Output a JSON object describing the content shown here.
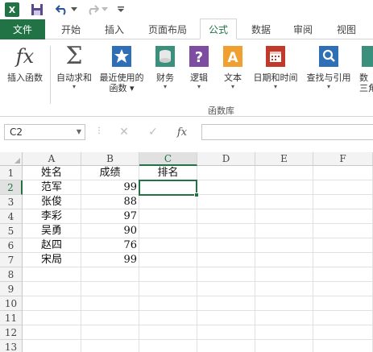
{
  "quick_access": {
    "app_logo": "X",
    "save_icon": "save-icon",
    "undo_icon": "undo-icon",
    "redo_icon": "redo-icon"
  },
  "tabs": [
    "文件",
    "开始",
    "插入",
    "页面布局",
    "公式",
    "数据",
    "审阅",
    "视图"
  ],
  "active_tab": "公式",
  "ribbon": {
    "buttons": [
      {
        "label": "插入函数",
        "label2": "",
        "dropdown": false,
        "icon": "fx-icon"
      },
      {
        "label": "自动求和",
        "label2": "",
        "dropdown": true,
        "icon": "sigma-icon"
      },
      {
        "label": "最近使用的",
        "label2": "函数",
        "dropdown": true,
        "icon": "star-book-icon"
      },
      {
        "label": "财务",
        "label2": "",
        "dropdown": true,
        "icon": "coins-book-icon"
      },
      {
        "label": "逻辑",
        "label2": "",
        "dropdown": true,
        "icon": "question-book-icon"
      },
      {
        "label": "文本",
        "label2": "",
        "dropdown": true,
        "icon": "text-book-icon"
      },
      {
        "label": "日期和时间",
        "label2": "",
        "dropdown": true,
        "icon": "calendar-book-icon"
      },
      {
        "label": "查找与引用",
        "label2": "",
        "dropdown": true,
        "icon": "search-book-icon"
      },
      {
        "label": "数",
        "label2": "三角",
        "dropdown": false,
        "icon": "math-book-icon"
      }
    ],
    "group_label": "函数库"
  },
  "formula_bar": {
    "name_box": "C2",
    "cancel_symbol": "✕",
    "enter_symbol": "✓",
    "fx_symbol": "fx",
    "formula": ""
  },
  "sheet": {
    "columns": [
      "A",
      "B",
      "C",
      "D",
      "E",
      "F"
    ],
    "selected_column": "C",
    "rows": [
      "1",
      "2",
      "3",
      "4",
      "5",
      "6",
      "7",
      "8",
      "9",
      "10",
      "11",
      "12",
      "13"
    ],
    "selected_row": "2",
    "cells": {
      "A": [
        "姓名",
        "范军",
        "张俊",
        "李彩",
        "吴勇",
        "赵四",
        "宋局"
      ],
      "B": [
        "成绩",
        "99",
        "88",
        "97",
        "90",
        "76",
        "99"
      ],
      "C": [
        "排名"
      ]
    }
  },
  "colors": {
    "accent": "#217346",
    "ribbon_icon_teal": "#2e7d9a",
    "ribbon_icon_purple": "#7e4ca0",
    "ribbon_icon_orange": "#f0a030",
    "ribbon_icon_red": "#c0392b"
  }
}
